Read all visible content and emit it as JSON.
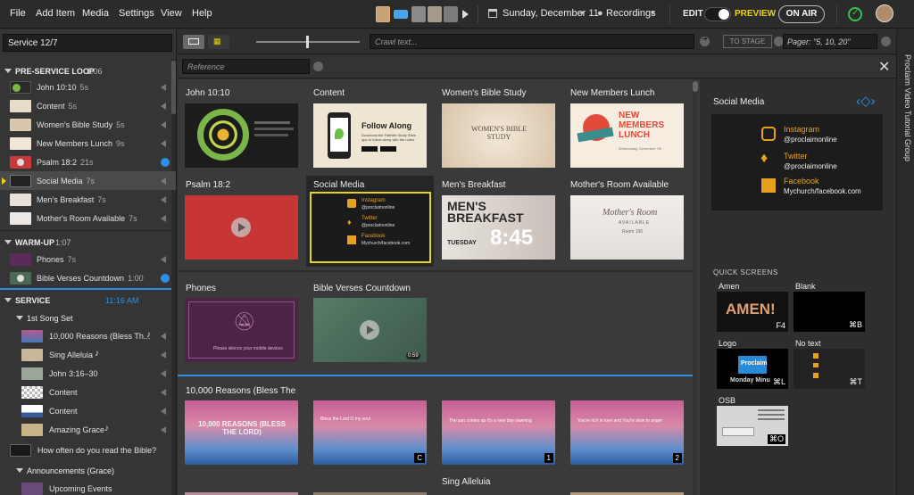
{
  "menu": [
    "File",
    "Add Item",
    "Media",
    "Settings",
    "View",
    "Help"
  ],
  "topbar": {
    "date": "Sunday, December 11",
    "recordings": "Recordings",
    "edit": "EDIT",
    "preview": "PREVIEW",
    "on_air": "ON AIR"
  },
  "toolbar": {
    "service_name": "Service 12/7",
    "crawl_placeholder": "Crawl text...",
    "to_stage": "TO STAGE",
    "pager_placeholder": "Pager: \"5, 10, 20\"",
    "reference_placeholder": "Reference"
  },
  "left": {
    "pre_service": {
      "label": "PRE-SERVICE LOOP",
      "time": "1:06"
    },
    "pre_items": [
      {
        "label": "John 10:10",
        "dur": "5s"
      },
      {
        "label": "Content",
        "dur": "5s"
      },
      {
        "label": "Women's Bible Study",
        "dur": "5s"
      },
      {
        "label": "New Members Lunch",
        "dur": "9s"
      },
      {
        "label": "Psalm 18:2",
        "dur": "21s"
      },
      {
        "label": "Social Media",
        "dur": "7s"
      },
      {
        "label": "Men's Breakfast",
        "dur": "7s"
      },
      {
        "label": "Mother's Room Available",
        "dur": "7s"
      }
    ],
    "warm_up": {
      "label": "WARM-UP",
      "time": "1:07"
    },
    "warm_items": [
      {
        "label": "Phones",
        "dur": "7s"
      },
      {
        "label": "Bible Verses Countdown",
        "dur": "1:00"
      }
    ],
    "service": {
      "label": "SERVICE",
      "time": "11:16 AM"
    },
    "song_set": "1st Song Set",
    "service_items": [
      {
        "label": "10,000 Reasons (Bless Th..."
      },
      {
        "label": "Sing Alleluia"
      },
      {
        "label": "John 3:16–30"
      },
      {
        "label": "Content"
      },
      {
        "label": "Content"
      },
      {
        "label": "Amazing Grace"
      },
      {
        "label": "How often do you read the Bible?"
      }
    ],
    "announcements": "Announcements (Grace)",
    "upcoming": "Upcoming Events"
  },
  "center": {
    "slides": [
      {
        "title": "John 10:10"
      },
      {
        "title": "Content",
        "text": "Follow Along",
        "sub": "Download the Faithlife Study Bible app to follow along with the notes"
      },
      {
        "title": "Women's Bible Study",
        "text": "WOMEN'S BIBLE STUDY"
      },
      {
        "title": "New Members Lunch",
        "text": "NEW MEMBERS LUNCH",
        "sub": "Wednesday, December 7th"
      },
      {
        "title": "Psalm 18:2"
      },
      {
        "title": "Social Media"
      },
      {
        "title": "Men's Breakfast",
        "text": "MEN'S BREAKFAST",
        "sub": "TUESDAY",
        "time": "8:45"
      },
      {
        "title": "Mother's Room Available",
        "text": "Mother's Room",
        "sub": "AVAILABLE",
        "sub2": "Room 106"
      },
      {
        "title": "Phones",
        "text": "Please silence your mobile devices"
      },
      {
        "title": "Bible Verses Countdown",
        "time": "0:59"
      }
    ],
    "song_title": "10,000 Reasons (Bless The",
    "song_slides": [
      {
        "text": "10,000 REASONS (BLESS THE LORD)",
        "badge": ""
      },
      {
        "text": "Bless the Lord O my soul",
        "badge": "C"
      },
      {
        "text": "The sun comes up it's a new day dawning",
        "badge": "1"
      },
      {
        "text": "You're rich in love and You're slow to anger",
        "badge": "2"
      }
    ],
    "sing_alleluia": "Sing Alleluia"
  },
  "social": {
    "title": "Social Media",
    "rows": [
      {
        "name": "Instagram",
        "handle": "@proclaimonline"
      },
      {
        "name": "Twitter",
        "handle": "@proclaimonline"
      },
      {
        "name": "Facebook",
        "handle": "Mychurch/facebook.com"
      }
    ]
  },
  "quick": {
    "title": "QUICK SCREENS",
    "items": [
      {
        "label": "Amen",
        "key": "F4",
        "text": "AMEN!"
      },
      {
        "label": "Blank",
        "key": "⌘B"
      },
      {
        "label": "Logo",
        "key": "⌘L",
        "text": "Proclaim",
        "sub": "Monday Minu"
      },
      {
        "label": "No text",
        "key": "⌘T"
      },
      {
        "label": "OSB",
        "key": "⌘O"
      }
    ]
  },
  "vertical_tab": "Proclaim Video Tutorial Group",
  "colors": {
    "accent": "#2e8fe6",
    "preview": "#e9d40a",
    "selected": "#e4d422",
    "play": "#2e8fe6"
  }
}
